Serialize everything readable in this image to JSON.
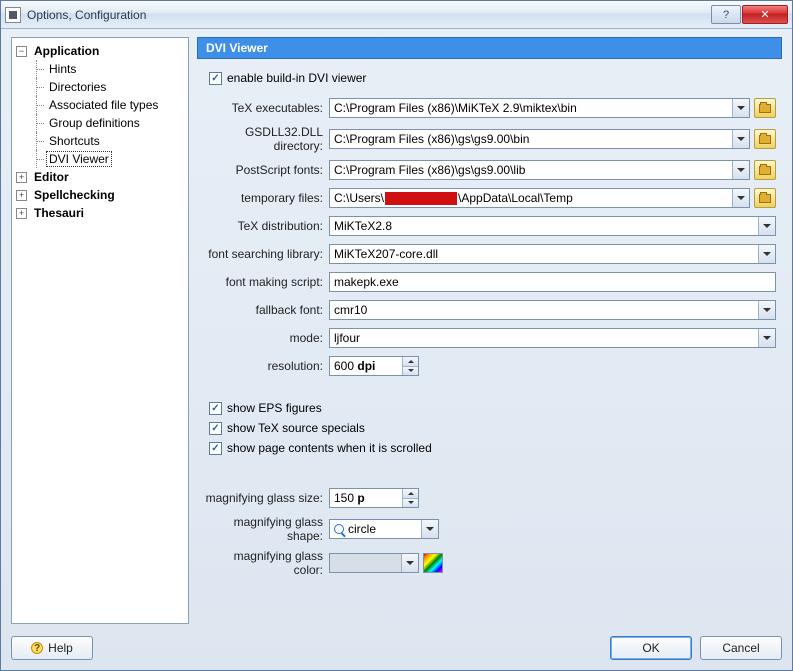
{
  "window": {
    "title": "Options, Configuration"
  },
  "tree": {
    "application": {
      "label": "Application",
      "children": [
        {
          "label": "Hints"
        },
        {
          "label": "Directories"
        },
        {
          "label": "Associated file types"
        },
        {
          "label": "Group definitions"
        },
        {
          "label": "Shortcuts"
        },
        {
          "label": "DVI Viewer"
        }
      ]
    },
    "editor": {
      "label": "Editor"
    },
    "spellchecking": {
      "label": "Spellchecking"
    },
    "thesauri": {
      "label": "Thesauri"
    }
  },
  "section": {
    "title": "DVI Viewer"
  },
  "form": {
    "enable_builtin": {
      "label": "enable build-in DVI viewer",
      "checked": true
    },
    "tex_executables": {
      "label": "TeX executables:",
      "value": "C:\\Program Files (x86)\\MiKTeX 2.9\\miktex\\bin"
    },
    "gsdll_dir": {
      "label": "GSDLL32.DLL directory:",
      "value": "C:\\Program Files (x86)\\gs\\gs9.00\\bin"
    },
    "postscript_fonts": {
      "label": "PostScript fonts:",
      "value": "C:\\Program Files (x86)\\gs\\gs9.00\\lib"
    },
    "temp_files": {
      "label": "temporary files:",
      "prefix": "C:\\Users\\",
      "suffix": "\\AppData\\Local\\Temp"
    },
    "tex_distribution": {
      "label": "TeX distribution:",
      "value": "MiKTeX2.8"
    },
    "font_library": {
      "label": "font searching library:",
      "value": "MiKTeX207-core.dll"
    },
    "font_script": {
      "label": "font making script:",
      "value": "makepk.exe"
    },
    "fallback_font": {
      "label": "fallback font:",
      "value": "cmr10"
    },
    "mode": {
      "label": "mode:",
      "value": "ljfour"
    },
    "resolution": {
      "label": "resolution:",
      "value": "600",
      "unit": "dpi"
    },
    "show_eps": {
      "label": "show EPS figures",
      "checked": true
    },
    "show_tex_specials": {
      "label": "show TeX source specials",
      "checked": true
    },
    "show_page_scroll": {
      "label": "show page contents when it is scrolled",
      "checked": true
    },
    "mag_size": {
      "label": "magnifying glass size:",
      "value": "150",
      "unit": "p"
    },
    "mag_shape": {
      "label": "magnifying glass shape:",
      "value": "circle"
    },
    "mag_color": {
      "label": "magnifying glass color:"
    }
  },
  "buttons": {
    "help": "Help",
    "ok": "OK",
    "cancel": "Cancel"
  }
}
